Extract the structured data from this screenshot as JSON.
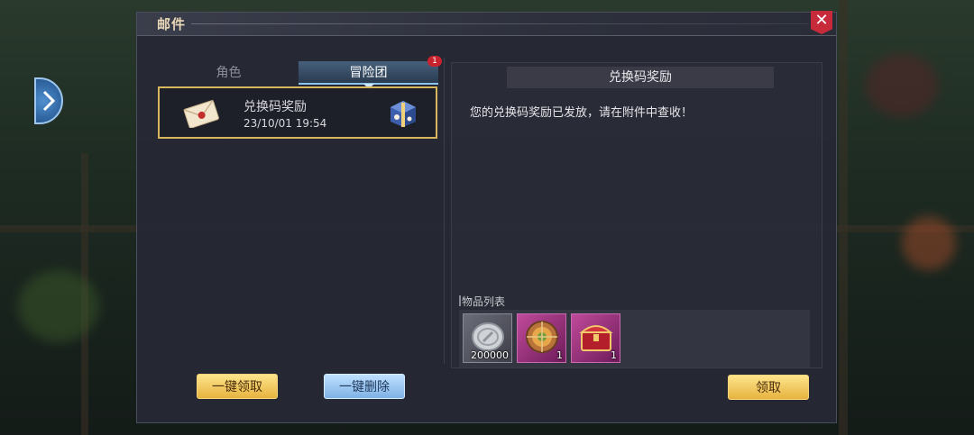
{
  "window": {
    "title": "邮件",
    "close_icon": "close-icon"
  },
  "tabs": [
    {
      "label": "角色",
      "active": false
    },
    {
      "label": "冒险团",
      "active": true,
      "badge": "1"
    }
  ],
  "mail_list": [
    {
      "subject": "兑换码奖励",
      "time": "23/10/01 19:54",
      "icon": "envelope-icon",
      "attachment_icon": "gift-box-icon",
      "selected": true
    }
  ],
  "detail": {
    "title": "兑换码奖励",
    "body": "您的兑换码奖励已发放，请在附件中查收！",
    "items_label": "物品列表",
    "items": [
      {
        "icon": "silver-coin-icon",
        "count": "200000",
        "rarity_color": "#6b6d78"
      },
      {
        "icon": "emblem-icon",
        "count": "1",
        "rarity_color": "#c04a9a"
      },
      {
        "icon": "treasure-chest-icon",
        "count": "1",
        "rarity_color": "#c04a9a"
      }
    ]
  },
  "buttons": {
    "claim_all": "一键领取",
    "delete_all": "一键删除",
    "claim": "领取"
  },
  "colors": {
    "accent_gold": "#e7b33f",
    "accent_blue": "#7fb2e6",
    "badge_red": "#c8232e",
    "selection_border": "#d7b65e"
  }
}
